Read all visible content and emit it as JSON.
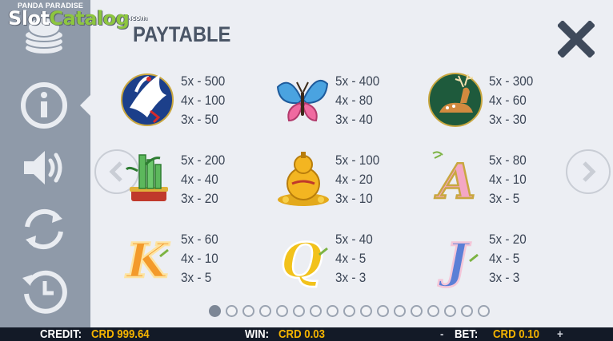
{
  "brand": {
    "game_name": "PANDA PARADISE",
    "logo_part1": "Slot",
    "logo_part2": "Catalog",
    "logo_suffix": ".com"
  },
  "sidebar": {
    "items": [
      {
        "name": "coins-icon"
      },
      {
        "name": "info-icon",
        "active": true
      },
      {
        "name": "sound-icon"
      },
      {
        "name": "autoplay-icon"
      },
      {
        "name": "history-icon"
      }
    ]
  },
  "paytable": {
    "title": "PAYTABLE",
    "symbols": [
      {
        "name": "crane",
        "icon": "crane-symbol",
        "pays": [
          "5x - 500",
          "4x - 100",
          "3x - 50"
        ]
      },
      {
        "name": "butterfly",
        "icon": "butterfly-symbol",
        "pays": [
          "5x - 400",
          "4x - 80",
          "3x - 40"
        ]
      },
      {
        "name": "deer",
        "icon": "deer-symbol",
        "pays": [
          "5x - 300",
          "4x - 60",
          "3x - 30"
        ]
      },
      {
        "name": "bamboo",
        "icon": "bamboo-symbol",
        "pays": [
          "5x - 200",
          "4x - 40",
          "3x - 20"
        ]
      },
      {
        "name": "gourd",
        "icon": "gold-gourd-symbol",
        "pays": [
          "5x - 100",
          "4x - 20",
          "3x - 10"
        ]
      },
      {
        "name": "A",
        "icon": "letter-a-symbol",
        "letter": "A",
        "pays": [
          "5x - 80",
          "4x - 10",
          "3x - 5"
        ]
      },
      {
        "name": "K",
        "icon": "letter-k-symbol",
        "letter": "K",
        "pays": [
          "5x - 60",
          "4x - 10",
          "3x - 5"
        ]
      },
      {
        "name": "Q",
        "icon": "letter-q-symbol",
        "letter": "Q",
        "pays": [
          "5x - 40",
          "4x - 5",
          "3x - 3"
        ]
      },
      {
        "name": "J",
        "icon": "letter-j-symbol",
        "letter": "J",
        "pays": [
          "5x - 20",
          "4x - 5",
          "3x - 3"
        ]
      }
    ],
    "page_count": 17,
    "current_page": 1
  },
  "status": {
    "credit_label": "CREDIT:",
    "credit_value": "CRD 999.64",
    "win_label": "WIN:",
    "win_value": "CRD 0.03",
    "bet_minus": "-",
    "bet_label": "BET:",
    "bet_value": "CRD 0.10",
    "bet_plus": "+"
  },
  "colors": {
    "sidebar": "#8f9aa9",
    "background": "#eceef3",
    "text": "#3c4656",
    "accent_value": "#f5b400",
    "bottom_bar": "#131a27"
  }
}
